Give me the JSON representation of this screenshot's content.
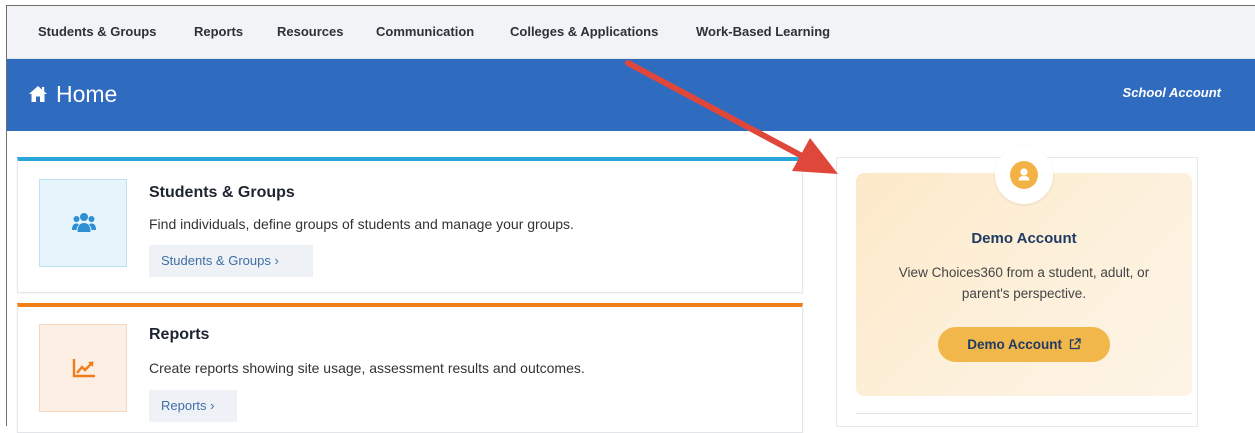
{
  "topnav": {
    "items": [
      "Students & Groups",
      "Reports",
      "Resources",
      "Communication",
      "Colleges & Applications",
      "Work-Based Learning"
    ]
  },
  "header": {
    "title": "Home",
    "account": "School Account",
    "icon": "home-icon",
    "bg_color": "#2f6bbf"
  },
  "cards": {
    "students": {
      "title": "Students & Groups",
      "description": "Find individuals, define groups of students and manage your groups.",
      "button": "Students & Groups ›",
      "icon": "users-icon",
      "accent": "#2aa7da"
    },
    "reports": {
      "title": "Reports",
      "description": "Create reports showing site usage, assessment results and outcomes.",
      "button": "Reports ›",
      "icon": "trend-chart-icon",
      "accent": "#f07f17"
    }
  },
  "demo": {
    "title": "Demo Account",
    "description": "View Choices360 from a student, adult, or parent's perspective.",
    "button": "Demo Account",
    "button_icon": "external-link-icon",
    "icon": "user-icon",
    "button_color": "#f1b74b"
  },
  "annotation": {
    "arrow_color": "#e0473b"
  }
}
